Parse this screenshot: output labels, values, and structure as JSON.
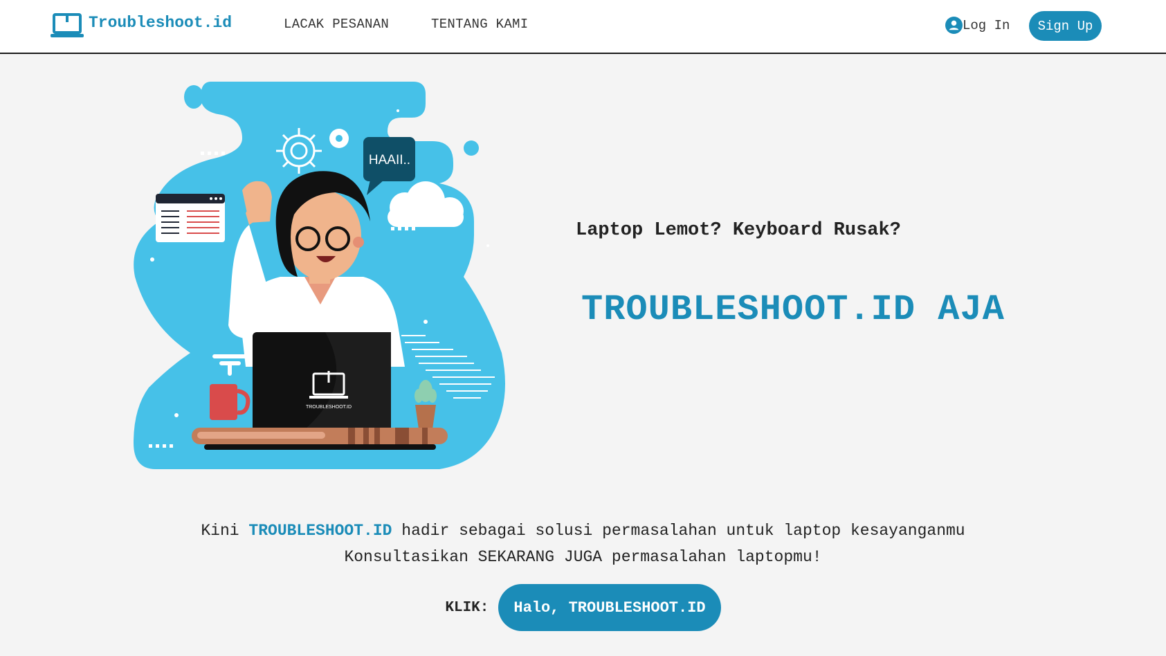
{
  "navbar": {
    "brand_text": "Troubleshoot.id",
    "links": [
      "LACAK PESANAN",
      "TENTANG KAMI"
    ],
    "login_label": "Log In",
    "signup_label": "Sign Up"
  },
  "hero": {
    "speech_bubble": "HAAII..",
    "laptop_logo_text": "TROUBLESHOOT.ID",
    "tagline": "Laptop Lemot? Keyboard Rusak?",
    "headline": "TROUBLESHOOT.ID AJA"
  },
  "description": {
    "line1_prefix": "Kini",
    "line1_brand": "TROUBLESHOOT.ID",
    "line1_suffix": "hadir sebagai solusi permasalahan untuk laptop kesayanganmu",
    "line2": "Konsultasikan SEKARANG JUGA permasalahan laptopmu!"
  },
  "cta": {
    "label": "KLIK:",
    "button": "Halo, TROUBLESHOOT.ID"
  },
  "colors": {
    "accent": "#1b8cb8",
    "illustration_blob": "#46c1e8",
    "background": "#f4f4f4"
  },
  "icons": {
    "brand": "laptop-icon",
    "login": "user-icon"
  }
}
